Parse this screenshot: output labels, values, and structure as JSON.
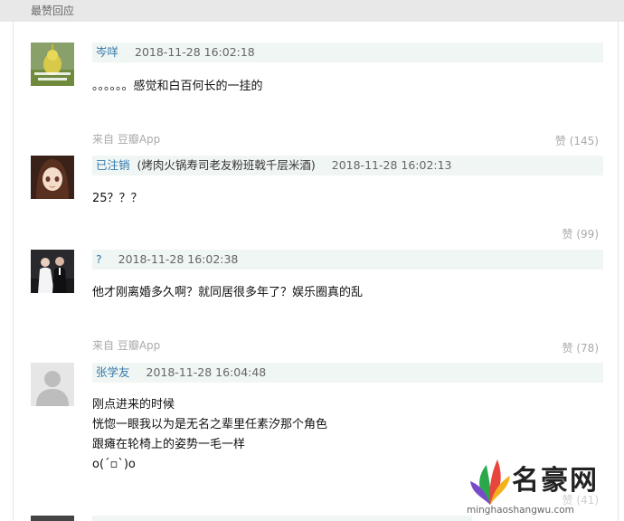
{
  "section_title": "最赞回应",
  "comments": [
    {
      "author": "岑咩",
      "group": "",
      "time": "2018-11-28 16:02:18",
      "lines": [
        "。。。。。。感觉和白百何长的一挂的"
      ],
      "source": "来自 豆瓣App",
      "votes": "赞 (145)"
    },
    {
      "author": "已注销",
      "group": "(烤肉火锅寿司老友粉班戟千层米酒)",
      "time": "2018-11-28 16:02:13",
      "lines": [
        "25？？？"
      ],
      "source": "",
      "votes": "赞 (99)"
    },
    {
      "author": "?",
      "group": "",
      "time": "2018-11-28 16:02:38",
      "lines": [
        "他才刚离婚多久啊？就同居很多年了？娱乐圈真的乱"
      ],
      "source": "来自 豆瓣App",
      "votes": "赞 (78)"
    },
    {
      "author": "张学友",
      "group": "",
      "time": "2018-11-28 16:04:48",
      "lines": [
        "刚点进来的时候",
        "恍惚一眼我以为是无名之辈里任素汐那个角色",
        "跟瘫在轮椅上的姿势一毛一样",
        "o(´▫`)o"
      ],
      "source": "",
      "votes": "赞 (41)"
    }
  ],
  "watermark": {
    "title": "名豪网",
    "url": "minghaoshangwu.com"
  },
  "colors": {
    "link": "#3377aa",
    "meta_bg": "#f0f6f3",
    "header_bg": "#e8e8e8",
    "muted": "#aaaaaa"
  }
}
